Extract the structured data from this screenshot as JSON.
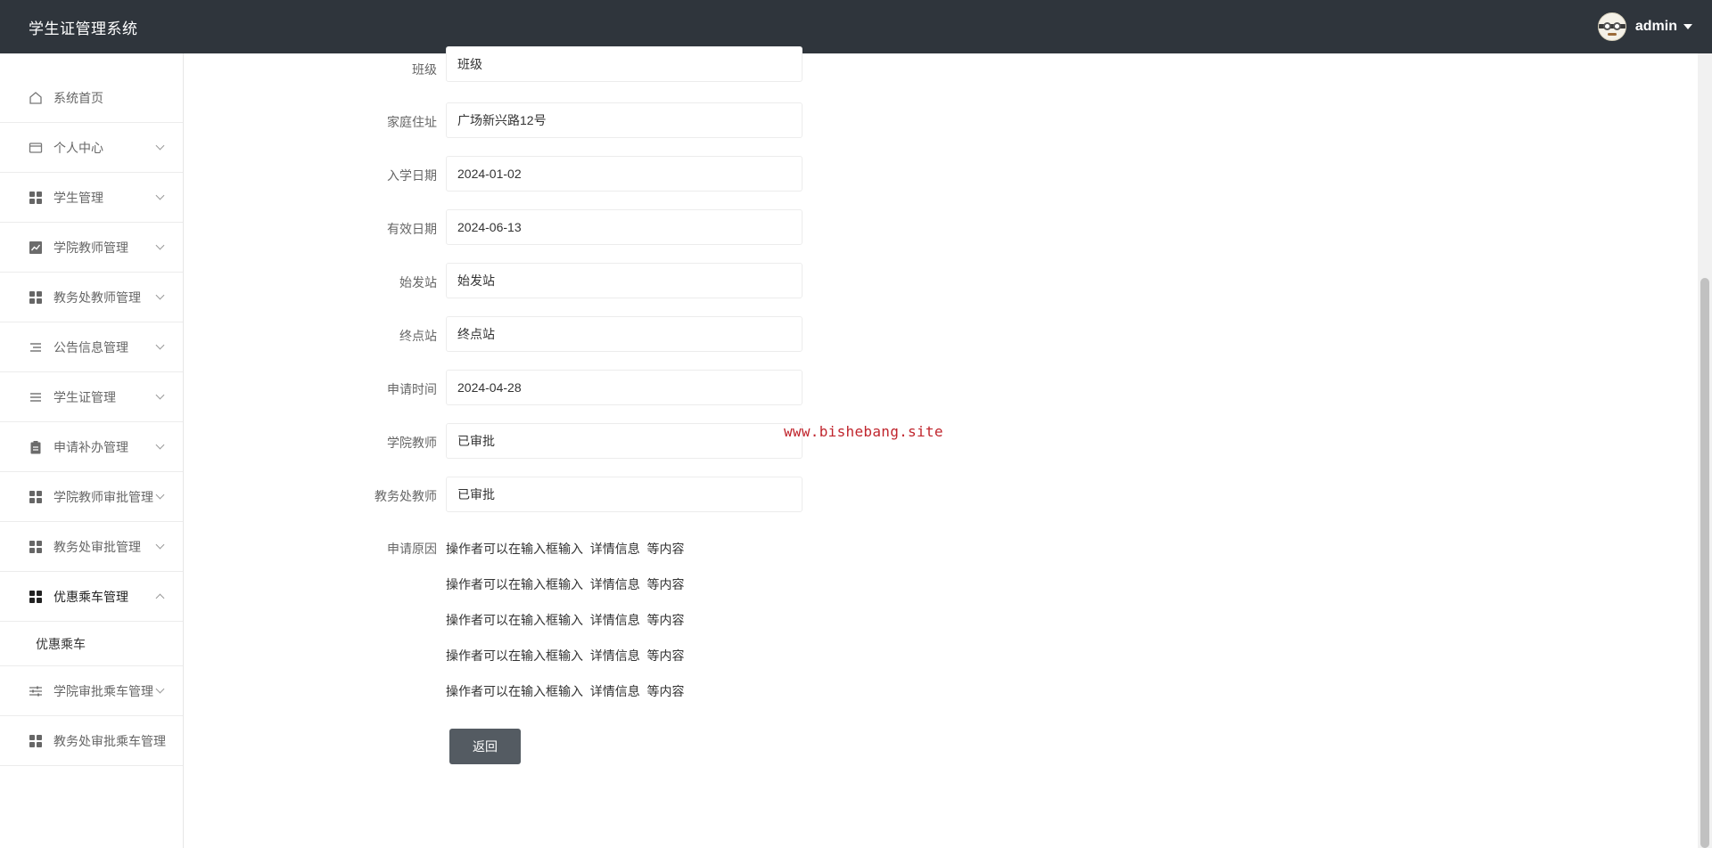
{
  "header": {
    "title": "学生证管理系统",
    "username": "admin"
  },
  "sidebar": {
    "items": [
      {
        "label": "系统首页",
        "icon": "home-icon"
      },
      {
        "label": "个人中心",
        "icon": "card-icon"
      },
      {
        "label": "学生管理",
        "icon": "grid-icon"
      },
      {
        "label": "学院教师管理",
        "icon": "chart-icon"
      },
      {
        "label": "教务处教师管理",
        "icon": "grid-icon"
      },
      {
        "label": "公告信息管理",
        "icon": "list-icon"
      },
      {
        "label": "学生证管理",
        "icon": "list-icon"
      },
      {
        "label": "申请补办管理",
        "icon": "clipboard-icon"
      },
      {
        "label": "学院教师审批管理",
        "icon": "grid-icon"
      },
      {
        "label": "教务处审批管理",
        "icon": "grid-icon"
      },
      {
        "label": "优惠乘车管理",
        "icon": "grid-icon"
      },
      {
        "label": "学院审批乘车管理",
        "icon": "sliders-icon"
      },
      {
        "label": "教务处审批乘车管理",
        "icon": "grid-icon"
      }
    ],
    "submenu": {
      "label": "优惠乘车"
    }
  },
  "form": {
    "class": {
      "label": "班级",
      "value": "班级"
    },
    "address": {
      "label": "家庭住址",
      "value": "广场新兴路12号"
    },
    "enroll_date": {
      "label": "入学日期",
      "value": "2024-01-02"
    },
    "valid_date": {
      "label": "有效日期",
      "value": "2024-06-13"
    },
    "start_station": {
      "label": "始发站",
      "value": "始发站"
    },
    "end_station": {
      "label": "终点站",
      "value": "终点站"
    },
    "apply_time": {
      "label": "申请时间",
      "value": "2024-04-28"
    },
    "college_teacher": {
      "label": "学院教师",
      "value": "已审批"
    },
    "office_teacher": {
      "label": "教务处教师",
      "value": "已审批"
    },
    "reason": {
      "label": "申请原因",
      "lines": [
        "操作者可以在输入框输入  详情信息  等内容",
        "操作者可以在输入框输入  详情信息  等内容",
        "操作者可以在输入框输入  详情信息  等内容",
        "操作者可以在输入框输入  详情信息  等内容",
        "操作者可以在输入框输入  详情信息  等内容"
      ]
    },
    "back_label": "返回"
  },
  "watermark": "www.bishebang.site",
  "colors": {
    "topbar": "#2f353c",
    "button": "#545b62",
    "watermark": "#c0252d"
  }
}
